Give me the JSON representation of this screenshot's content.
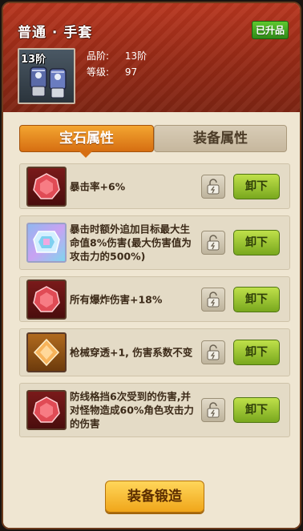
{
  "header": {
    "title": "普通 · 手套",
    "badge": "已升品",
    "item_level": "13阶",
    "stats": [
      {
        "label": "品阶:",
        "value": "13阶"
      },
      {
        "label": "等级:",
        "value": "97"
      }
    ]
  },
  "tabs": [
    {
      "label": "宝石属性",
      "active": true
    },
    {
      "label": "装备属性",
      "active": false
    }
  ],
  "gems": [
    {
      "icon": "red-gem-icon",
      "text": "暴击率+6%",
      "button": "卸下"
    },
    {
      "icon": "rainbow-gem-icon",
      "text": "暴击时额外追加目标最大生命值8%伤害(最大伤害值为攻击力的500%)",
      "button": "卸下"
    },
    {
      "icon": "red-gem-icon",
      "text": "所有爆炸伤害+18%",
      "button": "卸下"
    },
    {
      "icon": "orange-gem-icon",
      "text": "枪械穿透+1, 伤害系数不变",
      "button": "卸下"
    },
    {
      "icon": "red-gem-icon",
      "text": "防线格挡6次受到的伤害,并对怪物造成60%角色攻击力的伤害",
      "button": "卸下"
    }
  ],
  "footer": {
    "forge_label": "装备锻造"
  },
  "colors": {
    "header": "#952a16",
    "tab_active": "#e88a20",
    "button_green": "#8cbf2a",
    "button_gold": "#f5b82a"
  }
}
